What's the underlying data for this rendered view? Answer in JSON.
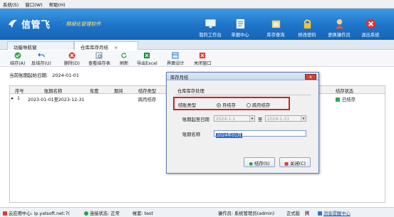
{
  "menu": {
    "items": [
      "系统(S)",
      "窗口(W)",
      "帮助(H)"
    ]
  },
  "banner": {
    "brand": "信管飞",
    "tagline": "· 精细化管理软件",
    "buttons": [
      {
        "label": "我的工作台",
        "icon": "desktop-icon"
      },
      {
        "label": "单据中心",
        "icon": "document-icon"
      },
      {
        "label": "库存查询",
        "icon": "warehouse-icon"
      },
      {
        "label": "修改密码",
        "icon": "lock-icon"
      },
      {
        "label": "更换操作员",
        "icon": "user-icon"
      },
      {
        "label": "退出系统",
        "icon": "exit-icon"
      }
    ]
  },
  "tabs": [
    {
      "label": "功能导航窗",
      "active": false
    },
    {
      "label": "仓库库存月结",
      "active": true,
      "close": "×"
    }
  ],
  "toolbar": {
    "items": [
      {
        "label": "结存(A)",
        "icon": "check-icon"
      },
      {
        "label": "反结存(U)",
        "icon": "undo-icon"
      },
      {
        "label": "删除(D)",
        "icon": "delete-icon"
      },
      {
        "label": "查看结存表",
        "icon": "view-icon"
      },
      {
        "label": "刷新",
        "icon": "refresh-icon"
      },
      {
        "label": "导出Excel",
        "icon": "excel-icon"
      },
      {
        "label": "界面设计",
        "icon": "design-icon"
      },
      {
        "label": "关闭窗口",
        "icon": "close-window-icon"
      }
    ]
  },
  "period": {
    "label": "当前账期起始日期:",
    "value": "2024-01-01"
  },
  "grid": {
    "columns": [
      "序号",
      "账期名称",
      "年度",
      "期间",
      "结存类型",
      "结存状态"
    ],
    "rows": [
      {
        "indicator": "▸",
        "no": "1",
        "name": "2023-01-01至2023-12-31",
        "year": "",
        "period": "",
        "type": "跨月结存",
        "status": "已结存"
      }
    ]
  },
  "dialog": {
    "title": "库存月结",
    "close": "x",
    "section": "仓库库存处理",
    "type_label": "结账类型",
    "radio_month": "月结存",
    "radio_cross": "跨月结存",
    "range_label": "账期起至日期",
    "start_date": "2024-1-1",
    "to": "至",
    "end_date": "2024-1-31",
    "name_label": "账期名称",
    "name_value": "2024年01月",
    "ok": "结存(S)",
    "cancel": "关闭(C)"
  },
  "statusbar": {
    "cloud": "云应用中心: ip.yatsoft.net:7(",
    "connection": "连接状态: 正常",
    "account": "帐套: test",
    "operator": "操作员: 系统管理员(admin)",
    "edition": "正式版",
    "user_label": "腾",
    "reminder": "消息提醒中心"
  },
  "colors": {
    "banner": "#1e73c8",
    "accent_red": "#d6201c",
    "selection": "#3067c4"
  }
}
